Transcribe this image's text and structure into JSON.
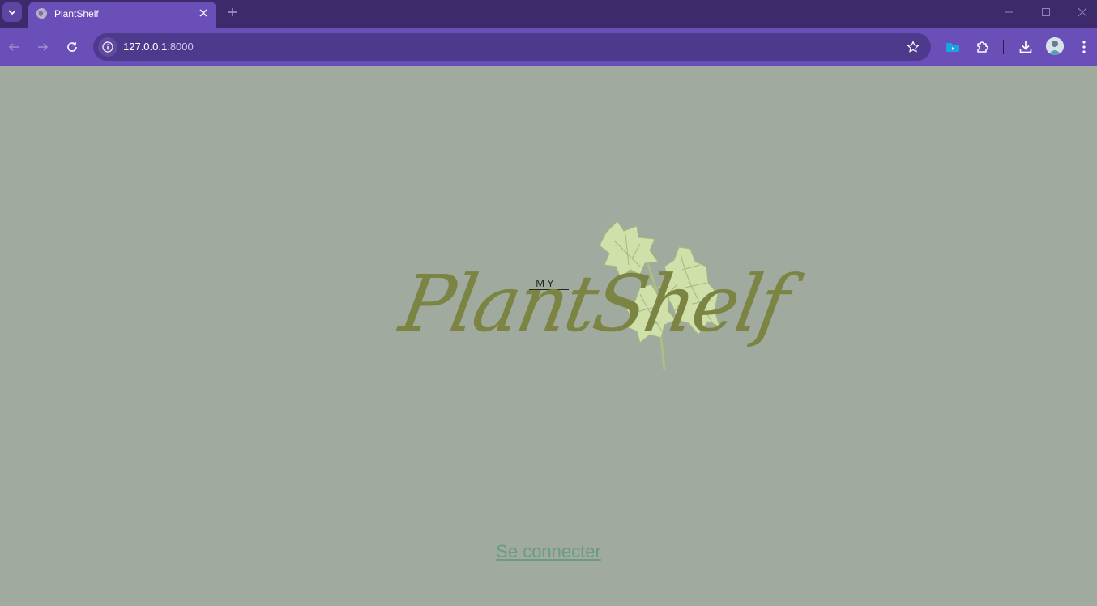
{
  "browser": {
    "tab": {
      "title": "PlantShelf",
      "favicon": "globe-icon"
    },
    "address": {
      "host": "127.0.0.1",
      "port": ":8000"
    },
    "icons": [
      "chevron-down-icon",
      "close-icon",
      "plus-icon",
      "minimize-icon",
      "maximize-icon",
      "close-window-icon",
      "back-arrow-icon",
      "forward-arrow-icon",
      "reload-icon",
      "info-icon",
      "star-icon",
      "folder-icon",
      "puzzle-icon",
      "download-icon",
      "kebab-menu-icon"
    ],
    "colors": {
      "titlebar": "#3c2a6b",
      "toolbar": "#6a4fb8",
      "omnibox": "#4e3a8c"
    }
  },
  "page": {
    "logo": {
      "my": "MY",
      "brand": "PlantShelf"
    },
    "login_link": "Se connecter",
    "colors": {
      "background": "#a0aa9e",
      "brand": "#7b8442",
      "leaf": "#cfe0a8",
      "link": "#6b9b82"
    }
  }
}
